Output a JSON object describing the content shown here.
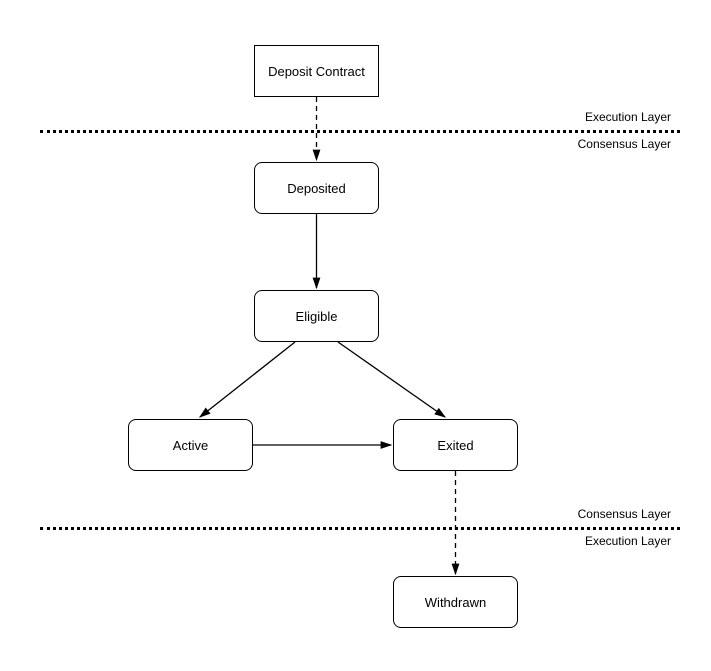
{
  "nodes": {
    "deposit_contract": "Deposit Contract",
    "deposited": "Deposited",
    "eligible": "Eligible",
    "active": "Active",
    "exited": "Exited",
    "withdrawn": "Withdrawn"
  },
  "labels": {
    "exec_upper": "Execution Layer",
    "cons_upper": "Consensus Layer",
    "cons_lower": "Consensus Layer",
    "exec_lower": "Execution Layer"
  },
  "chart_data": {
    "type": "diagram",
    "title": "",
    "nodes": [
      {
        "id": "deposit_contract",
        "label": "Deposit Contract",
        "layer": "Execution Layer",
        "shape": "rect-sharp"
      },
      {
        "id": "deposited",
        "label": "Deposited",
        "layer": "Consensus Layer",
        "shape": "rect-round"
      },
      {
        "id": "eligible",
        "label": "Eligible",
        "layer": "Consensus Layer",
        "shape": "rect-round"
      },
      {
        "id": "active",
        "label": "Active",
        "layer": "Consensus Layer",
        "shape": "rect-round"
      },
      {
        "id": "exited",
        "label": "Exited",
        "layer": "Consensus Layer",
        "shape": "rect-round"
      },
      {
        "id": "withdrawn",
        "label": "Withdrawn",
        "layer": "Execution Layer",
        "shape": "rect-round"
      }
    ],
    "edges": [
      {
        "from": "deposit_contract",
        "to": "deposited",
        "style": "dashed"
      },
      {
        "from": "deposited",
        "to": "eligible",
        "style": "solid"
      },
      {
        "from": "eligible",
        "to": "active",
        "style": "solid"
      },
      {
        "from": "eligible",
        "to": "exited",
        "style": "solid"
      },
      {
        "from": "active",
        "to": "exited",
        "style": "solid"
      },
      {
        "from": "exited",
        "to": "withdrawn",
        "style": "dashed"
      }
    ],
    "layers": [
      {
        "name": "Execution Layer",
        "position": "top"
      },
      {
        "name": "Consensus Layer",
        "position": "middle"
      },
      {
        "name": "Execution Layer",
        "position": "bottom"
      }
    ]
  }
}
